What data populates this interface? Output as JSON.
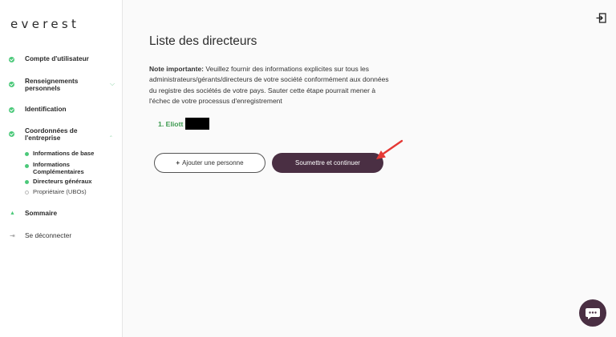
{
  "sidebar": {
    "logo": "everest",
    "items": [
      {
        "label": "Compte d'utilisateur"
      },
      {
        "label": "Renseignements personnels"
      },
      {
        "label": "Identification"
      },
      {
        "label": "Coordonnées de l'entreprise"
      }
    ],
    "sub_items": [
      {
        "label": "Informations de base",
        "done": true
      },
      {
        "label": "Informations Complémentaires",
        "done": true
      },
      {
        "label": "Directeurs généraux",
        "done": true
      },
      {
        "label": "Propriétaire (UBOs)",
        "done": false
      }
    ],
    "summary": "Sommaire",
    "logout": "Se déconnecter"
  },
  "main": {
    "title": "Liste des directeurs",
    "note_bold": "Note importante:",
    "note_text": " Veuillez fournir des informations explicites sur tous les administrateurs/gérants/directeurs de votre société conformément aux données du registre des sociétés de votre pays. Sauter cette étape pourrait mener à l'échec de votre processus d'enregistrement",
    "director": "1. Eliott",
    "add_button": "Ajouter une personne",
    "add_icon": "+",
    "submit_button": "Soumettre et continuer"
  },
  "colors": {
    "accent": "#4a2f43",
    "success": "#4cc97a",
    "director_text": "#3d9a4f",
    "annotation_arrow": "#e53935"
  }
}
